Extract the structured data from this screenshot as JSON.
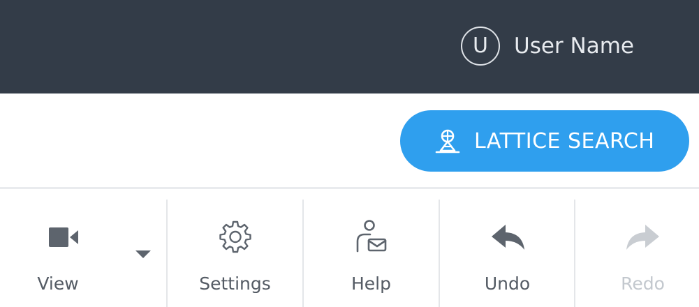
{
  "header": {
    "user": {
      "avatar_initial": "U",
      "name": "User Name"
    }
  },
  "search": {
    "button_label": "LATTICE SEARCH",
    "button_color": "#2f9fee"
  },
  "toolbar": {
    "items": [
      {
        "label": "View",
        "icon": "video-camera-icon",
        "has_dropdown": true,
        "enabled": true
      },
      {
        "label": "Settings",
        "icon": "gear-icon",
        "enabled": true
      },
      {
        "label": "Help",
        "icon": "person-mail-icon",
        "enabled": true
      },
      {
        "label": "Undo",
        "icon": "undo-arrow-icon",
        "enabled": true
      },
      {
        "label": "Redo",
        "icon": "redo-arrow-icon",
        "enabled": false
      }
    ]
  },
  "colors": {
    "header_bg": "#333c48",
    "icon_color": "#5d646d",
    "disabled_color": "#c9cdd2"
  }
}
